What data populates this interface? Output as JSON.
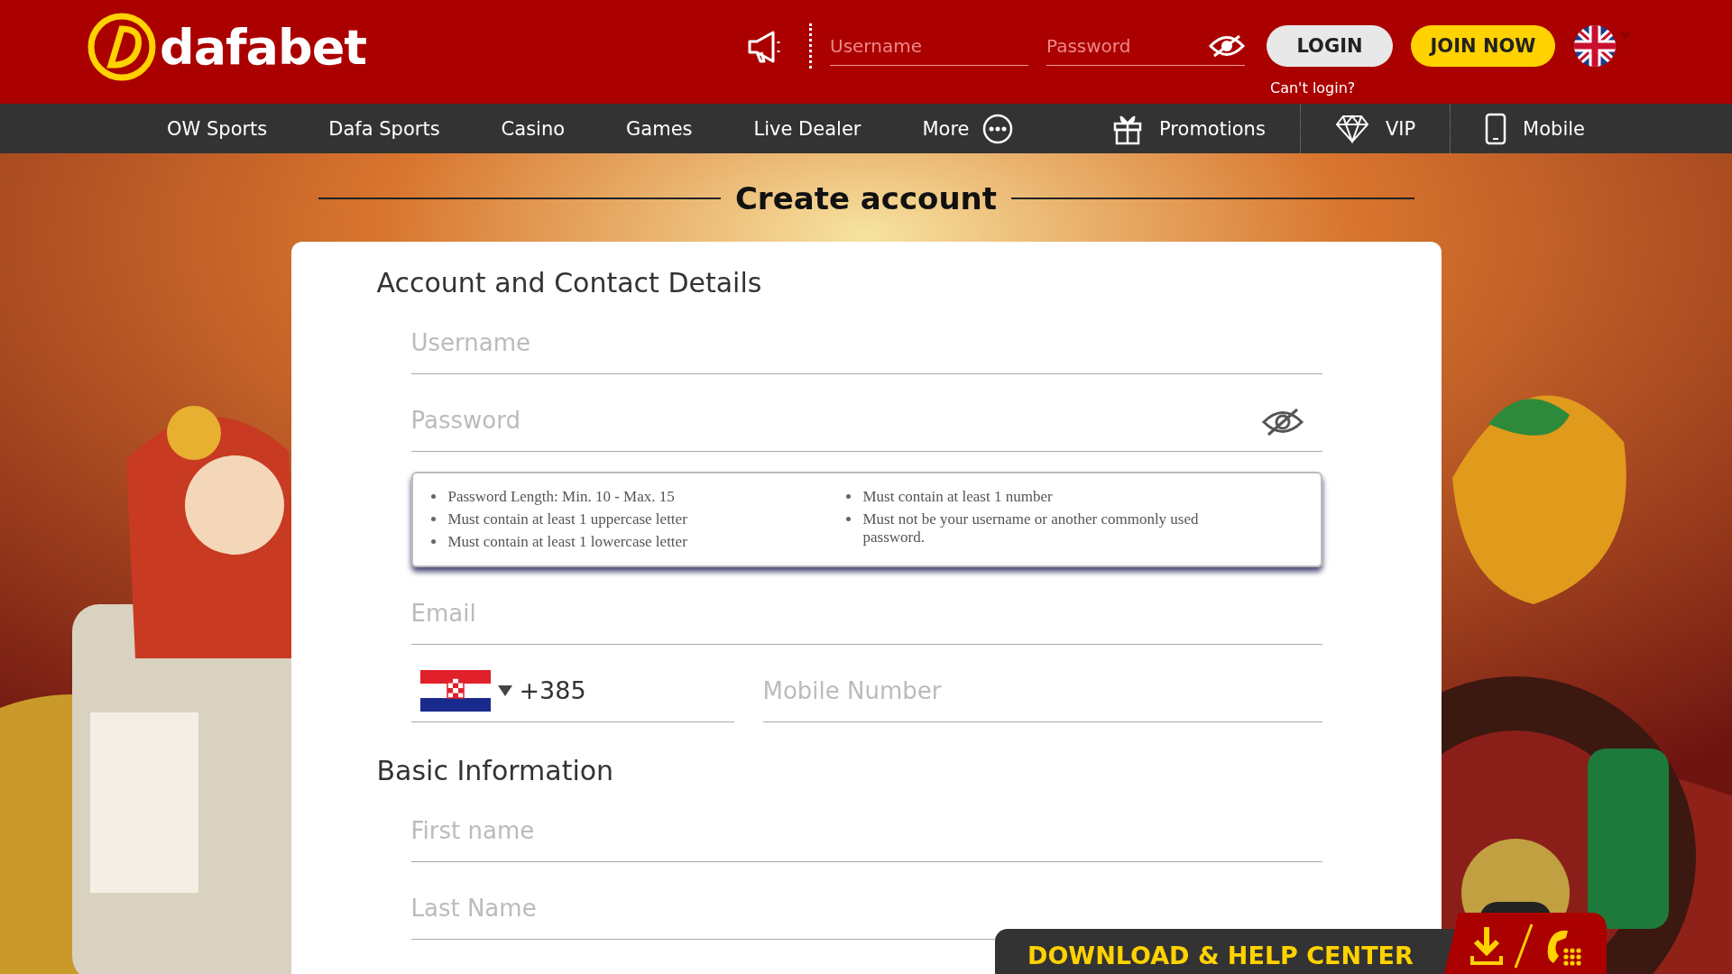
{
  "logo": {
    "text": "dafabet"
  },
  "header": {
    "username": {
      "placeholder": "Username"
    },
    "password": {
      "placeholder": "Password"
    },
    "login": "LOGIN",
    "join": "JOIN NOW",
    "cant_login": "Can't login?"
  },
  "nav": {
    "items": [
      {
        "label": "OW Sports"
      },
      {
        "label": "Dafa Sports"
      },
      {
        "label": "Casino"
      },
      {
        "label": "Games"
      },
      {
        "label": "Live Dealer"
      }
    ],
    "more": "More",
    "right": [
      {
        "label": "Promotions",
        "kind": "gift"
      },
      {
        "label": "VIP",
        "kind": "diamond"
      },
      {
        "label": "Mobile",
        "kind": "phone"
      }
    ]
  },
  "page_title": "Create account",
  "account_section": {
    "heading": "Account and Contact Details",
    "username": {
      "placeholder": "Username"
    },
    "password": {
      "placeholder": "Password"
    },
    "password_rules": {
      "column_1": [
        "Password Length: Min. 10 - Max. 15",
        "Must contain at least 1 uppercase letter",
        "Must contain at least 1 lowercase letter"
      ],
      "column_2": [
        "Must contain at least 1 number",
        "Must not be your username or another commonly used password."
      ]
    },
    "email": {
      "placeholder": "Email"
    },
    "phone": {
      "code": "+385",
      "placeholder": "Mobile Number"
    }
  },
  "basic_section": {
    "heading": "Basic Information",
    "first_name": {
      "placeholder": "First name"
    },
    "last_name": {
      "placeholder": "Last Name"
    }
  },
  "help_bar": {
    "label": "DOWNLOAD & HELP CENTER"
  }
}
